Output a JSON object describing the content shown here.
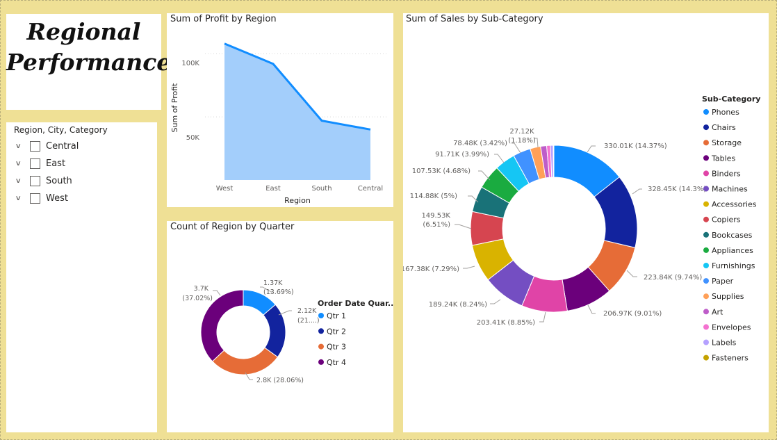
{
  "title": {
    "line1": "Regional",
    "line2": "Performance"
  },
  "slicer": {
    "header": "Region, City, Category",
    "items": [
      "Central",
      "East",
      "South",
      "West"
    ]
  },
  "profit_chart": {
    "title": "Sum of Profit by Region",
    "xlabel": "Region",
    "ylabel": "Sum of Profit",
    "y_ticks": [
      "100K",
      "50K"
    ],
    "categories": [
      "West",
      "East",
      "South",
      "Central"
    ]
  },
  "quarter_chart": {
    "title": "Count of Region by Quarter",
    "legend_title": "Order Date Quar...",
    "labels": [
      {
        "line1": "1.37K",
        "line2": "(13.69%)"
      },
      {
        "line1": "2.12K",
        "line2": "(21....)"
      },
      {
        "line1": "2.8K (28.06%)",
        "line2": ""
      },
      {
        "line1": "3.7K",
        "line2": "(37.02%)"
      }
    ]
  },
  "subcat_chart": {
    "title": "Sum of Sales by Sub-Category",
    "legend_title": "Sub-Category",
    "labels": [
      {
        "line1": "330.01K (14.37%)",
        "line2": ""
      },
      {
        "line1": "328.45K (14.3%)",
        "line2": ""
      },
      {
        "line1": "223.84K (9.74%)",
        "line2": ""
      },
      {
        "line1": "206.97K (9.01%)",
        "line2": ""
      },
      {
        "line1": "203.41K (8.85%)",
        "line2": ""
      },
      {
        "line1": "189.24K (8.24%)",
        "line2": ""
      },
      {
        "line1": "167.38K (7.29%)",
        "line2": ""
      },
      {
        "line1": "149.53K",
        "line2": "(6.51%)"
      },
      {
        "line1": "114.88K (5%)",
        "line2": ""
      },
      {
        "line1": "107.53K (4.68%)",
        "line2": ""
      },
      {
        "line1": "91.71K (3.99%)",
        "line2": ""
      },
      {
        "line1": "78.48K (3.42%)",
        "line2": ""
      },
      {
        "line1": "27.12K",
        "line2": "(1.18%)"
      }
    ]
  },
  "chart_data": [
    {
      "type": "area",
      "title": "Sum of Profit by Region",
      "xlabel": "Region",
      "ylabel": "Sum of Profit",
      "categories": [
        "West",
        "East",
        "South",
        "Central"
      ],
      "values": [
        108000,
        92000,
        47000,
        40000
      ],
      "ylim": [
        0,
        120000
      ],
      "color": "#118dff",
      "fill": "#a3cefb",
      "grid": true
    },
    {
      "type": "pie",
      "title": "Count of Region by Quarter",
      "legend_title": "Order Date Quar...",
      "labels": [
        "Qtr 1",
        "Qtr 2",
        "Qtr 3",
        "Qtr 4"
      ],
      "values": [
        1370,
        2120,
        2800,
        3700
      ],
      "percents": [
        13.69,
        21.23,
        28.06,
        37.02
      ],
      "colors": [
        "#118dff",
        "#12239e",
        "#e66c37",
        "#6b007b"
      ],
      "donut": true,
      "legend_position": "right"
    },
    {
      "type": "pie",
      "title": "Sum of Sales by Sub-Category",
      "legend_title": "Sub-Category",
      "labels": [
        "Phones",
        "Chairs",
        "Storage",
        "Tables",
        "Binders",
        "Machines",
        "Accessories",
        "Copiers",
        "Bookcases",
        "Appliances",
        "Furnishings",
        "Paper",
        "Supplies",
        "Art",
        "Envelopes",
        "Labels",
        "Fasteners"
      ],
      "values": [
        330010,
        328450,
        223840,
        206970,
        203410,
        189240,
        167380,
        149530,
        114880,
        107530,
        91710,
        78480,
        46670,
        27120,
        16480,
        12490,
        3020
      ],
      "percents": [
        14.37,
        14.3,
        9.74,
        9.01,
        8.85,
        8.24,
        7.29,
        6.51,
        5.0,
        4.68,
        3.99,
        3.42,
        2.03,
        1.18,
        0.72,
        0.54,
        0.13
      ],
      "colors": [
        "#118dff",
        "#12239e",
        "#e66c37",
        "#6b007b",
        "#e044a7",
        "#744ec2",
        "#d9b300",
        "#d64550",
        "#197278",
        "#1aab40",
        "#15c6f4",
        "#4092ff",
        "#ffa058",
        "#be5dc9",
        "#f472d0",
        "#b5a1ff",
        "#c4a200"
      ],
      "donut": true,
      "legend_position": "right"
    }
  ]
}
